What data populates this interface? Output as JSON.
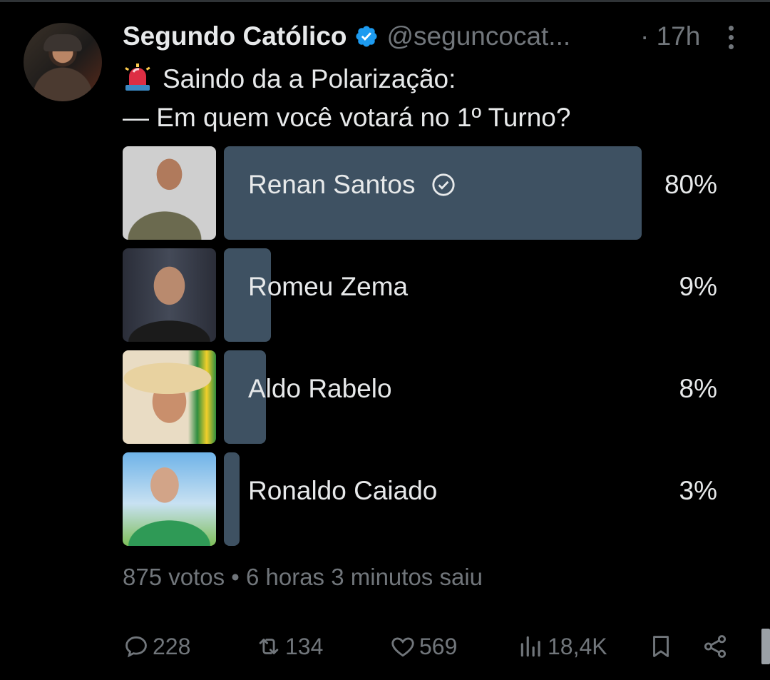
{
  "tweet": {
    "author_name": "Segundo Católico",
    "handle": "@seguncocat...",
    "time": "· 17h",
    "line1": "Saindo da a Polarização:",
    "line2": "— Em quem você votará no 1º Turno?"
  },
  "poll": {
    "options": [
      {
        "label": "Renan Santos",
        "percent_text": "80%",
        "percent": 80,
        "selected": true
      },
      {
        "label": "Romeu Zema",
        "percent_text": "9%",
        "percent": 9,
        "selected": false
      },
      {
        "label": "Aldo Rabelo",
        "percent_text": "8%",
        "percent": 8,
        "selected": false
      },
      {
        "label": "Ronaldo Caiado",
        "percent_text": "3%",
        "percent": 3,
        "selected": false
      }
    ],
    "meta": "875 votos • 6 horas 3 minutos saiu"
  },
  "actions": {
    "replies": "228",
    "reposts": "134",
    "likes": "569",
    "views": "18,4K"
  },
  "colors": {
    "background": "#000000",
    "text": "#e7e9ea",
    "muted": "#71767b",
    "poll_bar": "#3e5162",
    "verified": "#1d9bf0"
  }
}
